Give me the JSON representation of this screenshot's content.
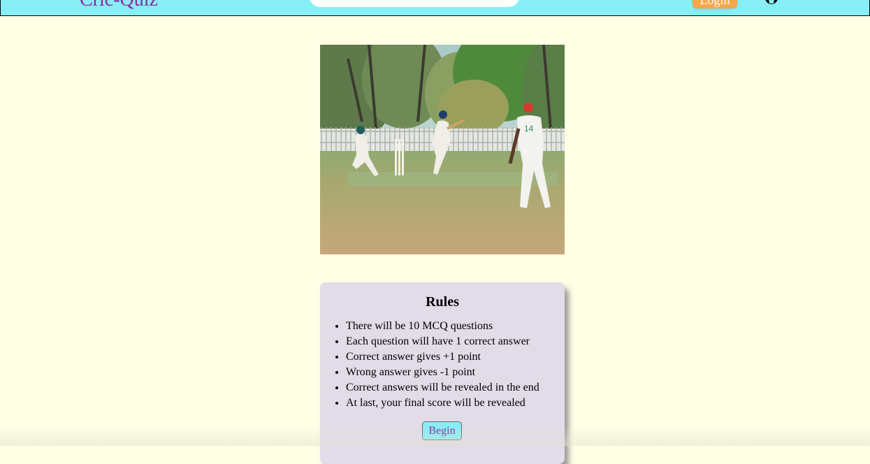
{
  "navbar": {
    "brand": "Cric-Quiz",
    "search_placeholder": "",
    "login_label": "Login",
    "icons": [
      "github-icon"
    ]
  },
  "hero": {
    "image_description_icon": "cricket-match-photo"
  },
  "rules": {
    "title": "Rules",
    "items": [
      "There will be 10 MCQ questions",
      "Each question will have 1 correct answer",
      "Correct answer gives +1 point",
      "Wrong answer gives -1 point",
      "Correct answers will be revealed in the end",
      "At last, your final score will be revealed"
    ],
    "begin_label": "Begin"
  },
  "colors": {
    "background": "#ffffe6",
    "navbar": "#87eef5",
    "brand": "#8a2ba0",
    "login_button": "#f7a648",
    "rules_card": "#e2dbe8"
  }
}
